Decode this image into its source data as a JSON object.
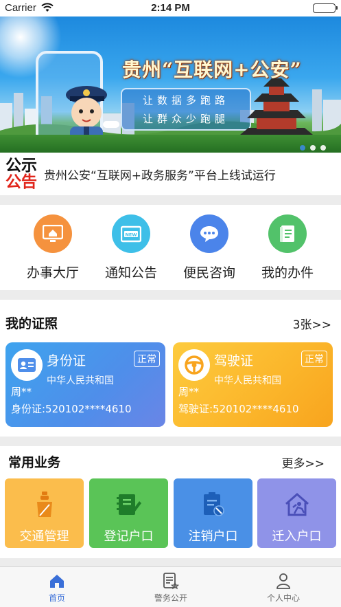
{
  "status_bar": {
    "carrier": "Carrier",
    "time": "2:14 PM"
  },
  "banner": {
    "headline": "贵州“互联网+公安”",
    "slogan_line1": "让数据多跑路",
    "slogan_line2": "让群众少跑腿",
    "slide_count": 3,
    "active_slide": 0
  },
  "notice": {
    "badge_line1": "公示",
    "badge_line2": "公告",
    "text": "贵州公安“互联网+政务服务”平台上线试运行"
  },
  "quick_menu": [
    {
      "label": "办事大厅",
      "icon": "monitor-home-icon",
      "color": "#f5923e"
    },
    {
      "label": "通知公告",
      "icon": "new-notice-icon",
      "color": "#3ebfe8"
    },
    {
      "label": "便民咨询",
      "icon": "chat-bubble-icon",
      "color": "#4b84ea"
    },
    {
      "label": "我的办件",
      "icon": "document-icon",
      "color": "#52c26a"
    }
  ],
  "certificates": {
    "title": "我的证照",
    "count_link": "3张>>",
    "cards": [
      {
        "type": "身份证",
        "status": "正常",
        "issuer": "中华人民共和国",
        "holder": "周**",
        "number": "身份证:520102****4610",
        "icon": "id-card-icon"
      },
      {
        "type": "驾驶证",
        "status": "正常",
        "issuer": "中华人民共和国",
        "holder": "周**",
        "number": "驾驶证:520102****4610",
        "icon": "steering-wheel-icon"
      }
    ]
  },
  "business": {
    "title": "常用业务",
    "more_link": "更多>>",
    "tiles": [
      {
        "label": "交通管理",
        "icon": "traffic-officer-icon",
        "color": "#fbbd4c"
      },
      {
        "label": "登记户口",
        "icon": "register-notebook-icon",
        "color": "#5ac457"
      },
      {
        "label": "注销户口",
        "icon": "cancel-clipboard-icon",
        "color": "#4a90e6"
      },
      {
        "label": "迁入户口",
        "icon": "move-in-house-icon",
        "color": "#8f93e8"
      }
    ]
  },
  "tab_bar": [
    {
      "label": "首页",
      "icon": "home-icon",
      "active": true
    },
    {
      "label": "警务公开",
      "icon": "police-document-icon",
      "active": false
    },
    {
      "label": "个人中心",
      "icon": "person-icon",
      "active": false
    }
  ]
}
